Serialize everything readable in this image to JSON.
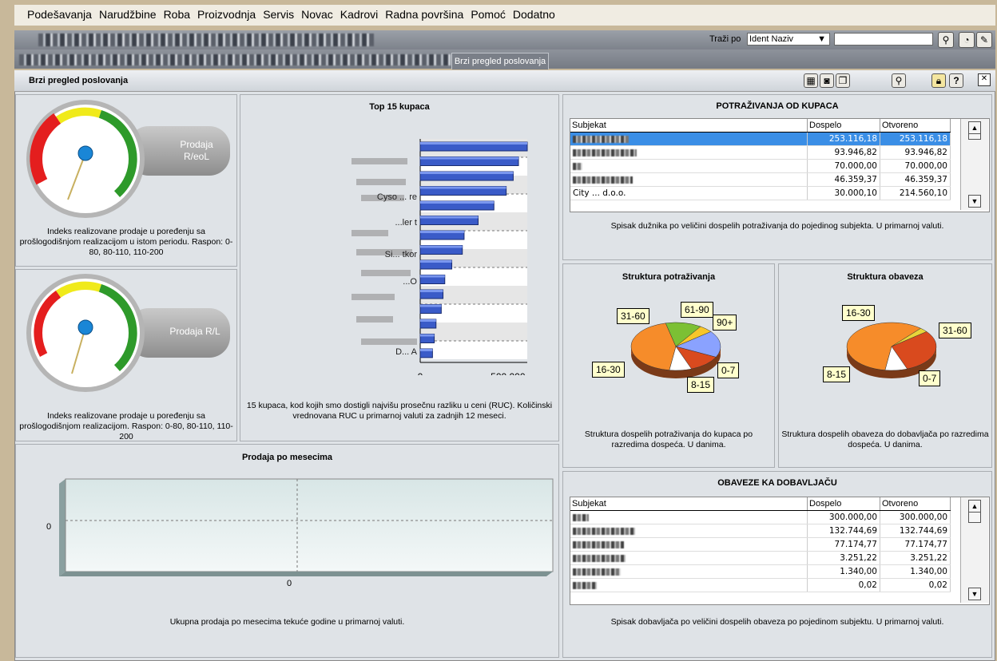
{
  "menu": [
    "Podešavanja",
    "Narudžbine",
    "Roba",
    "Proizvodnja",
    "Servis",
    "Novac",
    "Kadrovi",
    "Radna površina",
    "Pomoć",
    "Dodatno"
  ],
  "toolbar": {
    "search_label": "Traži po",
    "search_select": "Ident Naziv",
    "search_value": "",
    "search_button_icon": "search-icon",
    "gauge_button_icon": "speedometer-icon",
    "edit_button_icon": "edit-icon"
  },
  "tabs": {
    "active": "Brzi pregled poslovanja"
  },
  "window": {
    "title": "Brzi pregled poslovanja",
    "buttons": [
      "excel-export-icon",
      "camera-icon",
      "copy-icon",
      "zoom-icon",
      "lock-icon",
      "help-icon",
      "close-icon"
    ],
    "help_label": "?",
    "close_label": "✕"
  },
  "gauge1": {
    "label": "Prodaja R/eoL",
    "description": "Indeks realizovane prodaje u poređenju sa prošlogodišnjom realizacijom u istom periodu. Raspon: 0-80, 80-110, 110-200"
  },
  "gauge2": {
    "label": "Prodaja R/L",
    "description": "Indeks realizovane prodaje u poređenju sa prošlogodišnjom realizacijom. Raspon: 0-80, 80-110, 110-200"
  },
  "top_customers": {
    "title": "Top 15 kupaca",
    "x_ticks": [
      "0",
      "500.000"
    ],
    "visible_labels": [
      "Cyso ... re",
      "...ler t",
      "Si... tkor",
      "...O",
      "D... A"
    ],
    "description": "15 kupaca, kod kojih smo dostigli najvišu prosečnu razliku u ceni (RUC). Količinski vrednovana RUC u primarnoj valuti za zadnjih 12 meseci."
  },
  "sales_by_month": {
    "title": "Prodaja po mesecima",
    "y_tick": "0",
    "x_tick": "0",
    "description": "Ukupna prodaja po mesecima tekuće godine u primarnoj valuti."
  },
  "receivables": {
    "title": "POTRAŽIVANJA OD KUPACA",
    "columns": [
      "Subjekat",
      "Dospelo",
      "Otvoreno"
    ],
    "rows": [
      {
        "subject": "",
        "due": "253.116,18",
        "open": "253.116,18",
        "selected": true
      },
      {
        "subject": "",
        "due": "93.946,82",
        "open": "93.946,82"
      },
      {
        "subject": "",
        "due": "70.000,00",
        "open": "70.000,00"
      },
      {
        "subject": "",
        "due": "46.359,37",
        "open": "46.359,37"
      },
      {
        "subject": "City ... d.o.o.",
        "due": "30.000,10",
        "open": "214.560,10"
      }
    ],
    "description": "Spisak dužnika po veličini dospelih potraživanja do pojedinog subjekta. U primarnoj valuti."
  },
  "receivables_structure": {
    "title": "Struktura potraživanja",
    "labels": [
      "31-60",
      "61-90",
      "90+",
      "16-30",
      "0-7",
      "8-15"
    ],
    "description": "Struktura dospelih potraživanja do kupaca po razredima dospeća. U danima."
  },
  "liabilities_structure": {
    "title": "Struktura obaveza",
    "labels": [
      "16-30",
      "31-60",
      "8-15",
      "0-7"
    ],
    "description": "Struktura dospelih obaveza do dobavljača po razredima dospeća. U danima."
  },
  "liabilities": {
    "title": "OBAVEZE KA DOBAVLJAČU",
    "columns": [
      "Subjekat",
      "Dospelo",
      "Otvoreno"
    ],
    "rows": [
      {
        "subject": "",
        "due": "300.000,00",
        "open": "300.000,00"
      },
      {
        "subject": "",
        "due": "132.744,69",
        "open": "132.744,69"
      },
      {
        "subject": "",
        "due": "77.174,77",
        "open": "77.174,77"
      },
      {
        "subject": "",
        "due": "3.251,22",
        "open": "3.251,22"
      },
      {
        "subject": "",
        "due": "1.340,00",
        "open": "1.340,00"
      },
      {
        "subject": "",
        "due": "0,02",
        "open": "0,02"
      }
    ],
    "description": "Spisak dobavljača po veličini dospelih obaveza po pojedinom subjektu. U primarnoj valuti."
  },
  "chart_data": [
    {
      "type": "bar",
      "title": "Top 15 kupaca",
      "orientation": "horizontal",
      "categories": [
        "Cyso ... re",
        "...ler t",
        "Si... tkor",
        "...O",
        "D... A"
      ],
      "values": [
        610000,
        560000,
        530000,
        490000,
        420000,
        330000,
        250000,
        240000,
        180000,
        140000,
        130000,
        120000,
        90000,
        80000,
        70000
      ],
      "xlim": [
        0,
        610000
      ],
      "x_ticks": [
        0,
        500000
      ]
    },
    {
      "type": "pie",
      "title": "Struktura potraživanja",
      "labels": [
        "90+",
        "0-7",
        "8-15",
        "16-30",
        "31-60",
        "61-90"
      ],
      "values": [
        18,
        12,
        8,
        44,
        13,
        5
      ],
      "colors": [
        "#8aa2ff",
        "#d94a1e",
        "#ffffff",
        "#f68c2a",
        "#7cc034",
        "#f7c62a"
      ]
    },
    {
      "type": "pie",
      "title": "Struktura obaveza",
      "labels": [
        "0-7",
        "8-15",
        "16-30",
        "31-60"
      ],
      "values": [
        30,
        8,
        59,
        3
      ],
      "colors": [
        "#d94a1e",
        "#ffffff",
        "#f68c2a",
        "#e8d43a"
      ]
    },
    {
      "type": "line",
      "title": "Prodaja po mesecima",
      "x": [],
      "series": [],
      "y_ticks": [
        0
      ],
      "x_ticks": [
        0
      ]
    }
  ]
}
